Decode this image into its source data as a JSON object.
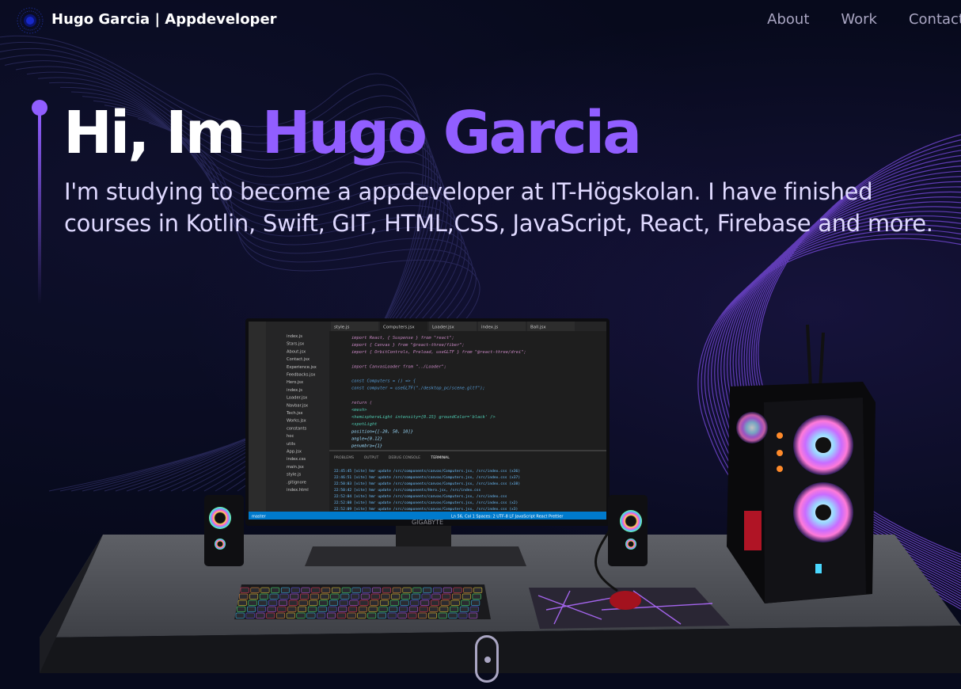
{
  "nav": {
    "brand": "Hugo Garcia  | Appdeveloper",
    "links": [
      "About",
      "Work",
      "Contact"
    ]
  },
  "hero": {
    "greeting": "Hi, Im ",
    "name": "Hugo Garcia",
    "subtitle": "I'm studying to become a appdeveloper at IT-Högskolan. I have finished courses in Kotlin, Swift, GIT, HTML,CSS, JavaScript, React, Firebase and more."
  },
  "scene": {
    "monitor_brand": "GIGABYTE",
    "editor": {
      "tabs": [
        "style.js",
        "Computers.jsx",
        "Loader.jsx",
        "index.js",
        "Ball.jsx"
      ],
      "files": [
        "index.js",
        "Stars.jsx",
        "About.jsx",
        "Contact.jsx",
        "Experience.jsx",
        "Feedbacks.jsx",
        "Hero.jsx",
        "index.js",
        "Loader.jsx",
        "Navbar.jsx",
        "Tech.jsx",
        "Works.jsx",
        "constants",
        "hoc",
        "utils",
        "App.jsx",
        "index.css",
        "main.jsx",
        "style.js",
        ".gitignore",
        "index.html"
      ],
      "code_lines": [
        "import React, { Suspense } from \"react\";",
        "import { Canvas } from \"@react-three/fiber\";",
        "import { OrbitControls, Preload, useGLTF } from \"@react-three/drei\";",
        "",
        "import CanvasLoader from \"../Loader\";",
        "",
        "const Computers = () => {",
        "  const computer = useGLTF(\"./desktop_pc/scene.gltf\");",
        "",
        "  return (",
        "    <mesh>",
        "      <hemisphereLight intensity={0.15} groundColor='black' />",
        "      <spotLight",
        "        position={[-20, 50, 10]}",
        "        angle={0.12}",
        "        penumbra={1}"
      ],
      "panel_tabs": [
        "PROBLEMS",
        "OUTPUT",
        "DEBUG CONSOLE",
        "TERMINAL"
      ],
      "terminal_lines": [
        "22:45:45 [vite] hmr update /src/components/canvas/Computers.jsx, /src/index.css (x36)",
        "22:46:51 [vite] hmr update /src/components/canvas/Computers.jsx, /src/index.css (x37)",
        "22:50:03 [vite] hmr update /src/components/canvas/Computers.jsx, /src/index.css (x38)",
        "22:50:42 [vite] hmr update /src/components/Hero.jsx, /src/index.css",
        "22:52:04 [vite] hmr update /src/components/canvas/Computers.jsx, /src/index.css",
        "22:52:08 [vite] hmr update /src/components/canvas/Computers.jsx, /src/index.css (x2)",
        "22:52:09 [vite] hmr update /src/components/canvas/Computers.jsx, /src/index.css (x3)"
      ],
      "status_left": "master",
      "status_right": "Ln 56, Col 1   Spaces: 2   UTF-8   LF   JavaScript React   Prettier"
    }
  },
  "colors": {
    "background": "#050816",
    "accent": "#915eff",
    "nav_text": "#aaa6c3",
    "subtitle": "#dfd9ff"
  }
}
